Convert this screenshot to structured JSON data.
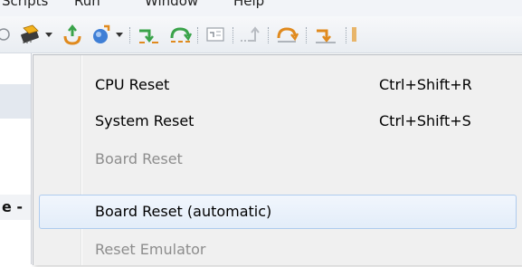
{
  "menubar": {
    "items": [
      "Scripts",
      "Run",
      "Window",
      "Help"
    ]
  },
  "toolbar": {
    "icons": [
      "refresh-icon-partial",
      "reset-chip-icon",
      "dropdown-arrow",
      "connect-icon",
      "launch-icon",
      "dropdown-arrow",
      "step-into-icon",
      "step-over-icon",
      "assembly-step-icon",
      "step-return-icon",
      "run-to-line-icon",
      "drop-to-frame-icon"
    ]
  },
  "left_panel": {
    "text": "e -"
  },
  "reset_menu": {
    "items": [
      {
        "label": "CPU Reset",
        "shortcut": "Ctrl+Shift+R",
        "enabled": true
      },
      {
        "label": "System Reset",
        "shortcut": "Ctrl+Shift+S",
        "enabled": true
      },
      {
        "label": "Board Reset",
        "shortcut": "",
        "enabled": false
      },
      {
        "label": "Board Reset (automatic)",
        "shortcut": "",
        "enabled": true,
        "highlighted": true
      },
      {
        "label": "Reset Emulator",
        "shortcut": "",
        "enabled": false
      }
    ]
  },
  "colors": {
    "menu_bg": "#f0f0f0",
    "highlight_border": "#aecbee",
    "disabled_text": "#8d8d8d",
    "step_green": "#3aa34a",
    "step_orange": "#e08a1e"
  }
}
